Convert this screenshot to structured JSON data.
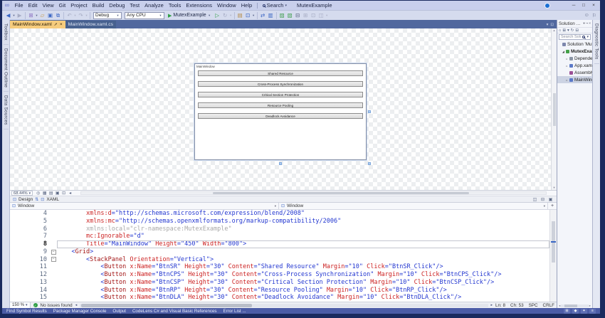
{
  "icons": {
    "infinity": "∞",
    "chevron_down": "▾",
    "chevron_up": "▴",
    "chevron_left": "◂",
    "chevron_right": "▸",
    "close": "×",
    "pin": "⊸",
    "play": "▶",
    "pane": "⊡",
    "swap": "⇅",
    "plus": "+",
    "check": "✓",
    "minimize": "─",
    "maximize": "□",
    "smiley": "☺",
    "flag": "⚐",
    "expanded": "◢",
    "collapsed": "▹",
    "fold_minus": "−"
  },
  "titlebar": {
    "menus": [
      "File",
      "Edit",
      "View",
      "Git",
      "Project",
      "Build",
      "Debug",
      "Test",
      "Analyze",
      "Tools",
      "Extensions",
      "Window",
      "Help"
    ],
    "search_label": "Search",
    "window_title": "MutexExample"
  },
  "toolbar": {
    "config": "Debug",
    "platform": "Any CPU",
    "run_label": "MutexExample",
    "items": [
      {
        "t": "icon",
        "g": "◀",
        "n": "navigate-back-icon",
        "c": "#3a66c4"
      },
      {
        "t": "dd"
      },
      {
        "t": "icon",
        "g": "▶",
        "n": "navigate-forward-icon",
        "dim": true
      },
      {
        "t": "sep"
      },
      {
        "t": "icon",
        "g": "⊞",
        "n": "new-project-icon",
        "c": "#8a6fc0"
      },
      {
        "t": "dd"
      },
      {
        "t": "icon",
        "g": "▱",
        "n": "open-file-icon",
        "c": "#c79b4e"
      },
      {
        "t": "icon",
        "g": "▣",
        "n": "save-icon",
        "c": "#3a66c4"
      },
      {
        "t": "icon",
        "g": "⧉",
        "n": "save-all-icon",
        "c": "#3a66c4"
      },
      {
        "t": "sep"
      },
      {
        "t": "icon",
        "g": "↶",
        "n": "undo-icon",
        "dim": true
      },
      {
        "t": "dd",
        "dim": true
      },
      {
        "t": "icon",
        "g": "↷",
        "n": "redo-icon",
        "dim": true
      },
      {
        "t": "dd",
        "dim": true
      },
      {
        "t": "sep"
      },
      {
        "t": "select",
        "bind": "config",
        "n": "solution-configurations-dropdown",
        "w": 40
      },
      {
        "t": "select",
        "bind": "platform",
        "n": "solution-platforms-dropdown",
        "w": 56
      },
      {
        "t": "run"
      },
      {
        "t": "icon",
        "g": "▷",
        "n": "start-without-debugging-icon",
        "c": "#2f9e44"
      },
      {
        "t": "icon",
        "g": "↻",
        "n": "hot-reload-icon",
        "dim": true
      },
      {
        "t": "dd",
        "dim": true
      },
      {
        "t": "sep"
      },
      {
        "t": "icon",
        "g": "▤",
        "n": "performance-profiler-icon",
        "c": "#b58a43"
      },
      {
        "t": "icon",
        "g": "⊡",
        "n": "preview-changes-icon",
        "c": "#3a66c4"
      },
      {
        "t": "dd"
      },
      {
        "t": "sep"
      },
      {
        "t": "icon",
        "g": "⇄",
        "n": "find-in-files-icon",
        "c": "#3a66c4"
      },
      {
        "t": "icon",
        "g": "▥",
        "n": "solution-explorer-view-icon",
        "c": "#3a66c4"
      },
      {
        "t": "sep"
      },
      {
        "t": "icon",
        "g": "▨",
        "n": "show-all-files-icon",
        "c": "#3f9e4d"
      },
      {
        "t": "icon",
        "g": "▧",
        "n": "properties-window-icon",
        "c": "#3f9e4d"
      },
      {
        "t": "icon",
        "g": "⊟",
        "n": "bookmark-icon",
        "c": "#5a6480"
      },
      {
        "t": "icon",
        "g": "⊞",
        "n": "extension-icon",
        "dim": true
      },
      {
        "t": "icon",
        "g": "⊡",
        "n": "navigate-backward-group-icon",
        "dim": true
      },
      {
        "t": "icon",
        "g": "◫",
        "n": "window-layout-icon",
        "dim": true
      },
      {
        "t": "dd",
        "dim": true
      }
    ]
  },
  "left_strip": {
    "tabs": [
      "Toolbox",
      "Document Outline",
      "Data Sources"
    ]
  },
  "right_strip": {
    "tab": "Diagnostic Tools"
  },
  "doc_tabs": [
    {
      "label": "MainWindow.xaml",
      "active": true
    },
    {
      "label": "MainWindow.xaml.cs",
      "active": false
    }
  ],
  "designer": {
    "window_title": "MainWindow",
    "buttons": [
      "Shared Resource",
      "Cross-Process Synchronization",
      "Critical Section Protection",
      "Resource Pooling",
      "Deadlock Avoidance"
    ],
    "zoom_level": "68.44%",
    "design_label": "Design",
    "xaml_label": "XAML",
    "zoom_icons": [
      {
        "g": "◎",
        "n": "zoom-fit-selection-icon"
      },
      {
        "g": "▦",
        "n": "show-snap-grid-icon"
      },
      {
        "g": "▤",
        "n": "snap-to-grid-icon"
      },
      {
        "g": "▣",
        "n": "snap-to-snaplines-icon"
      },
      {
        "g": "⊡",
        "n": "show-annotations-icon"
      },
      {
        "g": "◂",
        "n": "designer-scroll-left-icon"
      }
    ],
    "split_icons": [
      {
        "g": "◫",
        "n": "vertical-split-icon"
      },
      {
        "g": "⊟",
        "n": "horizontal-split-icon"
      },
      {
        "g": "▣",
        "n": "collapse-pane-icon"
      }
    ]
  },
  "breadcrumb": {
    "left": "Window",
    "right": "Window"
  },
  "editor": {
    "zoom": "150 %",
    "status": "No issues found",
    "ln": "Ln: 8",
    "ch": "Ch: 53",
    "spc": "SPC",
    "eol": "CRLF",
    "lines": [
      {
        "n": 4,
        "tok": [
          [
            "p",
            "        "
          ],
          [
            "a",
            "xmlns:d"
          ],
          [
            "v",
            "=\"http://schemas.microsoft.com/expression/blend/2008\""
          ]
        ]
      },
      {
        "n": 5,
        "tok": [
          [
            "p",
            "        "
          ],
          [
            "a",
            "xmlns:mc"
          ],
          [
            "v",
            "=\"http://schemas.openxmlformats.org/markup-compatibility/2006\""
          ]
        ]
      },
      {
        "n": 6,
        "tok": [
          [
            "g",
            "        xmlns:local=\"clr-namespace:MutexExample\""
          ]
        ]
      },
      {
        "n": 7,
        "tok": [
          [
            "p",
            "        "
          ],
          [
            "a",
            "mc:Ignorable"
          ],
          [
            "v",
            "=\"d\""
          ]
        ]
      },
      {
        "n": 8,
        "cur": true,
        "tok": [
          [
            "p",
            "        "
          ],
          [
            "a",
            "Title"
          ],
          [
            "v",
            "=\"MainWindow\""
          ],
          [
            "p",
            " "
          ],
          [
            "a",
            "Height"
          ],
          [
            "v",
            "=\"450\""
          ],
          [
            "p",
            " "
          ],
          [
            "a",
            "Width"
          ],
          [
            "v",
            "=\"800\""
          ],
          [
            "v",
            ">"
          ]
        ]
      },
      {
        "n": 9,
        "fold": true,
        "tok": [
          [
            "p",
            "    "
          ],
          [
            "v",
            "<"
          ],
          [
            "t",
            "Grid"
          ],
          [
            "v",
            ">"
          ]
        ]
      },
      {
        "n": 10,
        "fold": true,
        "tok": [
          [
            "p",
            "        "
          ],
          [
            "v",
            "<"
          ],
          [
            "t",
            "StackPanel"
          ],
          [
            "p",
            " "
          ],
          [
            "a",
            "Orientation"
          ],
          [
            "v",
            "=\"Vertical\""
          ],
          [
            "v",
            ">"
          ]
        ]
      },
      {
        "n": 11,
        "tok": [
          [
            "p",
            "            "
          ],
          [
            "v",
            "<"
          ],
          [
            "t",
            "Button"
          ],
          [
            "p",
            " "
          ],
          [
            "a",
            "x:Name"
          ],
          [
            "v",
            "=\"BtnSR\""
          ],
          [
            "p",
            " "
          ],
          [
            "a",
            "Height"
          ],
          [
            "v",
            "=\"30\""
          ],
          [
            "p",
            " "
          ],
          [
            "a",
            "Content"
          ],
          [
            "v",
            "=\"Shared Resource\""
          ],
          [
            "p",
            " "
          ],
          [
            "a",
            "Margin"
          ],
          [
            "v",
            "=\"10\""
          ],
          [
            "p",
            " "
          ],
          [
            "a",
            "Click"
          ],
          [
            "v",
            "=\"BtnSR_Click\""
          ],
          [
            "v",
            "/>"
          ]
        ]
      },
      {
        "n": 12,
        "tok": [
          [
            "p",
            "            "
          ],
          [
            "v",
            "<"
          ],
          [
            "t",
            "Button"
          ],
          [
            "p",
            " "
          ],
          [
            "a",
            "x:Name"
          ],
          [
            "v",
            "=\"BtnCPS\""
          ],
          [
            "p",
            " "
          ],
          [
            "a",
            "Height"
          ],
          [
            "v",
            "=\"30\""
          ],
          [
            "p",
            " "
          ],
          [
            "a",
            "Content"
          ],
          [
            "v",
            "=\"Cross-Process Synchronization\""
          ],
          [
            "p",
            " "
          ],
          [
            "a",
            "Margin"
          ],
          [
            "v",
            "=\"10\""
          ],
          [
            "p",
            " "
          ],
          [
            "a",
            "Click"
          ],
          [
            "v",
            "=\"BtnCPS_Click\""
          ],
          [
            "v",
            "/>"
          ]
        ]
      },
      {
        "n": 13,
        "tok": [
          [
            "p",
            "            "
          ],
          [
            "v",
            "<"
          ],
          [
            "t",
            "Button"
          ],
          [
            "p",
            " "
          ],
          [
            "a",
            "x:Name"
          ],
          [
            "v",
            "=\"BtnCSP\""
          ],
          [
            "p",
            " "
          ],
          [
            "a",
            "Height"
          ],
          [
            "v",
            "=\"30\""
          ],
          [
            "p",
            " "
          ],
          [
            "a",
            "Content"
          ],
          [
            "v",
            "=\"Critical Section Protection\""
          ],
          [
            "p",
            " "
          ],
          [
            "a",
            "Margin"
          ],
          [
            "v",
            "=\"10\""
          ],
          [
            "p",
            " "
          ],
          [
            "a",
            "Click"
          ],
          [
            "v",
            "=\"BtnCSP_Click\""
          ],
          [
            "v",
            "/>"
          ]
        ]
      },
      {
        "n": 14,
        "tok": [
          [
            "p",
            "            "
          ],
          [
            "v",
            "<"
          ],
          [
            "t",
            "Button"
          ],
          [
            "p",
            " "
          ],
          [
            "a",
            "x:Name"
          ],
          [
            "v",
            "=\"BtnRP\""
          ],
          [
            "p",
            " "
          ],
          [
            "a",
            "Height"
          ],
          [
            "v",
            "=\"30\""
          ],
          [
            "p",
            " "
          ],
          [
            "a",
            "Content"
          ],
          [
            "v",
            "=\"Resource Pooling\""
          ],
          [
            "p",
            " "
          ],
          [
            "a",
            "Margin"
          ],
          [
            "v",
            "=\"10\""
          ],
          [
            "p",
            " "
          ],
          [
            "a",
            "Click"
          ],
          [
            "v",
            "=\"BtnRP_Click\""
          ],
          [
            "v",
            "/>"
          ]
        ]
      },
      {
        "n": 15,
        "tok": [
          [
            "p",
            "            "
          ],
          [
            "v",
            "<"
          ],
          [
            "t",
            "Button"
          ],
          [
            "p",
            " "
          ],
          [
            "a",
            "x:Name"
          ],
          [
            "v",
            "=\"BtnDLA\""
          ],
          [
            "p",
            " "
          ],
          [
            "a",
            "Height"
          ],
          [
            "v",
            "=\"30\""
          ],
          [
            "p",
            " "
          ],
          [
            "a",
            "Content"
          ],
          [
            "v",
            "=\"Deadlock Avoidance\""
          ],
          [
            "p",
            " "
          ],
          [
            "a",
            "Margin"
          ],
          [
            "v",
            "=\"10\""
          ],
          [
            "p",
            " "
          ],
          [
            "a",
            "Click"
          ],
          [
            "v",
            "=\"BtnDLA_Click\""
          ],
          [
            "v",
            "/>"
          ]
        ]
      }
    ]
  },
  "solution_explorer": {
    "title": "Solution Explorer",
    "search_placeholder": "Search Solution Explorer (Ctrl+;)",
    "header_icons": [
      {
        "g": "▾",
        "n": "window-position-icon"
      },
      {
        "g": "⊸",
        "n": "auto-hide-pin-icon"
      },
      {
        "g": "×",
        "n": "close-icon"
      }
    ],
    "toolbar_icons": [
      {
        "g": "⌂",
        "n": "home-icon"
      },
      {
        "g": "⊞",
        "n": "switch-views-icon"
      },
      {
        "g": "▾",
        "n": "chevron-down-icon"
      },
      {
        "g": "↻",
        "n": "refresh-icon"
      },
      {
        "g": "⊟",
        "n": "collapse-all-icon"
      }
    ],
    "icon_colors": {
      "solution": "#7d87ad",
      "project": "#43a047",
      "dependencies": "#8b95a5",
      "xaml_file": "#5b79c8",
      "cs_file": "#9b4f96"
    },
    "tree": [
      {
        "label": "Solution 'MutexExample'",
        "level": 0,
        "icon": "solution",
        "exp": "none"
      },
      {
        "label": "MutexExample",
        "level": 1,
        "icon": "project",
        "exp": "expanded",
        "bold": true
      },
      {
        "label": "Dependencies",
        "level": 2,
        "icon": "dependencies",
        "exp": "collapsed"
      },
      {
        "label": "App.xaml",
        "level": 2,
        "icon": "xaml_file",
        "exp": "collapsed"
      },
      {
        "label": "AssemblyInfo.cs",
        "level": 2,
        "icon": "cs_file",
        "exp": "none"
      },
      {
        "label": "MainWindow.xaml",
        "level": 2,
        "icon": "xaml_file",
        "exp": "collapsed",
        "selected": true
      }
    ]
  },
  "bottom_bar": {
    "tabs": [
      "Find Symbol Results",
      "Package Manager Console",
      "Output",
      "CodeLens C# and Visual Basic References",
      "Error List ..."
    ],
    "icons": [
      {
        "g": "⊞",
        "n": "panel-grid-icon"
      },
      {
        "g": "◆",
        "n": "status-diamond-icon"
      },
      {
        "g": "✦",
        "n": "sparkle-icon"
      },
      {
        "g": "≡",
        "n": "menu-icon"
      }
    ]
  },
  "colors": {
    "frame": "#1b2a5e",
    "active_tab": "#f6cc7d",
    "run_green": "#2f9e44",
    "attr_red": "#cc2222",
    "value_blue": "#2236d0",
    "tag_red": "#a31515"
  }
}
